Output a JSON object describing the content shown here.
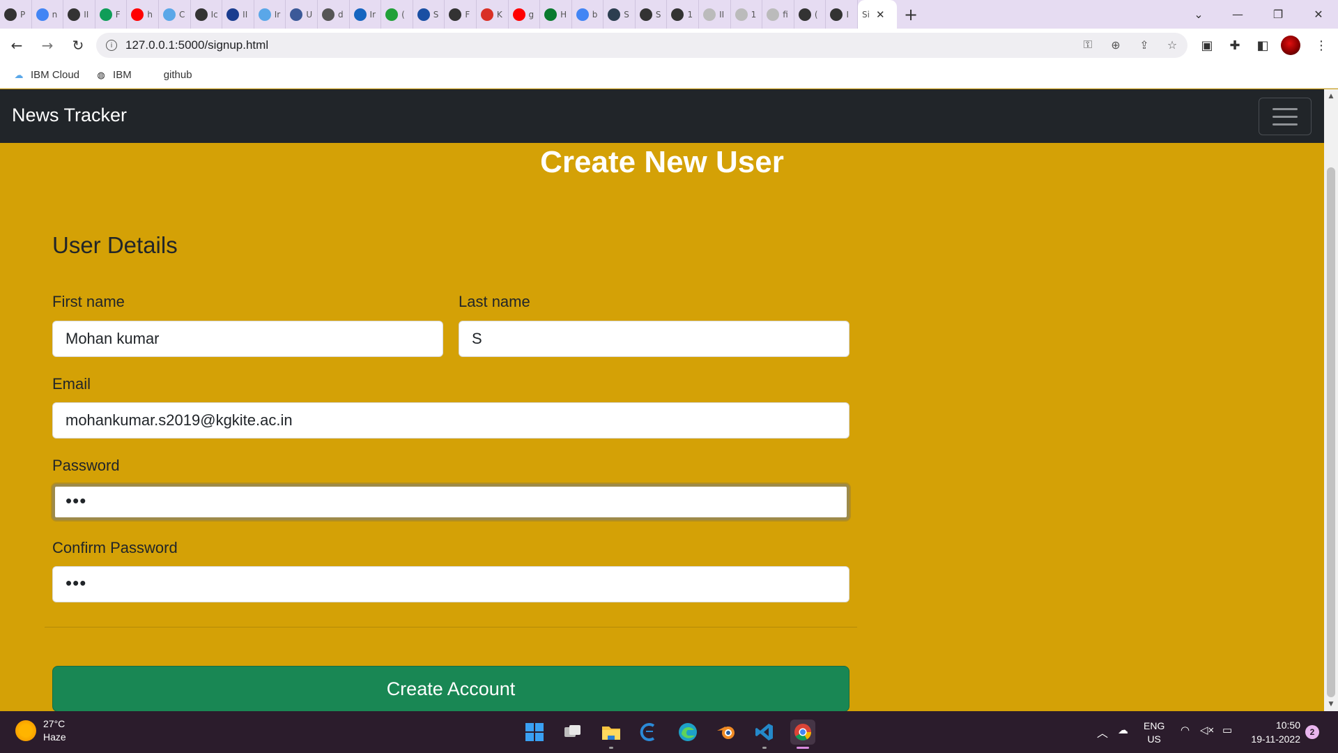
{
  "browser": {
    "tabs": [
      {
        "letter": "P",
        "color": "#333333",
        "icon": "globe-icon"
      },
      {
        "letter": "n",
        "color": "#4285f4",
        "icon": "google-icon"
      },
      {
        "letter": "II",
        "color": "#333333",
        "icon": "globe-icon"
      },
      {
        "letter": "F",
        "color": "#0f9d58",
        "icon": "drive-icon"
      },
      {
        "letter": "h",
        "color": "#ff0000",
        "icon": "youtube-icon"
      },
      {
        "letter": "C",
        "color": "#5aa7e8",
        "icon": "cloud-icon"
      },
      {
        "letter": "Ic",
        "color": "#333333",
        "icon": "globe-icon"
      },
      {
        "letter": "II",
        "color": "#1a3d8f",
        "icon": "grid-icon"
      },
      {
        "letter": "Ir",
        "color": "#5aa7e8",
        "icon": "cloud-icon"
      },
      {
        "letter": "U",
        "color": "#3b5998",
        "icon": "people-icon"
      },
      {
        "letter": "d",
        "color": "#555555",
        "icon": "bike-icon"
      },
      {
        "letter": "Ir",
        "color": "#1565c0",
        "icon": "doc-icon"
      },
      {
        "letter": "(",
        "color": "#21a038",
        "icon": "dollar-icon"
      },
      {
        "letter": "S",
        "color": "#1a4fa3",
        "icon": "shield-icon"
      },
      {
        "letter": "F",
        "color": "#333333",
        "icon": "github-icon"
      },
      {
        "letter": "K",
        "color": "#d93025",
        "icon": "gmail-icon"
      },
      {
        "letter": "g",
        "color": "#ff0000",
        "icon": "youtube-icon"
      },
      {
        "letter": "H",
        "color": "#0a7a2f",
        "icon": "w-icon"
      },
      {
        "letter": "b",
        "color": "#4285f4",
        "icon": "google-icon"
      },
      {
        "letter": "S",
        "color": "#2c3e50",
        "icon": "tds-icon"
      },
      {
        "letter": "S",
        "color": "#333333",
        "icon": "globe-icon"
      },
      {
        "letter": "1",
        "color": "#333333",
        "icon": "globe-icon"
      },
      {
        "letter": "II",
        "color": "#bbbbbb",
        "icon": "github-icon"
      },
      {
        "letter": "1",
        "color": "#bbbbbb",
        "icon": "globe-icon"
      },
      {
        "letter": "fi",
        "color": "#bbbbbb",
        "icon": "globe-icon"
      },
      {
        "letter": "(",
        "color": "#333333",
        "icon": "globe-icon"
      },
      {
        "letter": "I",
        "color": "#333333",
        "icon": "globe-icon"
      }
    ],
    "active_tab_label": "Si",
    "url": "127.0.0.1:5000/signup.html",
    "bookmarks": [
      {
        "label": "IBM Cloud",
        "icon": "cloud-icon"
      },
      {
        "label": "IBM",
        "icon": "globe-icon"
      },
      {
        "label": "github",
        "icon": "none"
      }
    ]
  },
  "page": {
    "brand": "News Tracker",
    "heading": "Create New User",
    "section_title": "User Details",
    "fields": {
      "first_name": {
        "label": "First name",
        "value": "Mohan kumar"
      },
      "last_name": {
        "label": "Last name",
        "value": "S"
      },
      "email": {
        "label": "Email",
        "value": "mohankumar.s2019@kgkite.ac.in"
      },
      "password": {
        "label": "Password",
        "value": "•••"
      },
      "confirm_password": {
        "label": "Confirm Password",
        "value": "•••"
      }
    },
    "submit_label": "Create Account",
    "colors": {
      "background": "#d4a106",
      "navbar": "#212529",
      "button": "#198754"
    }
  },
  "taskbar": {
    "temperature": "27°C",
    "weather": "Haze",
    "lang_top": "ENG",
    "lang_bottom": "US",
    "time": "10:50",
    "date": "19-11-2022",
    "notifications": "2"
  }
}
